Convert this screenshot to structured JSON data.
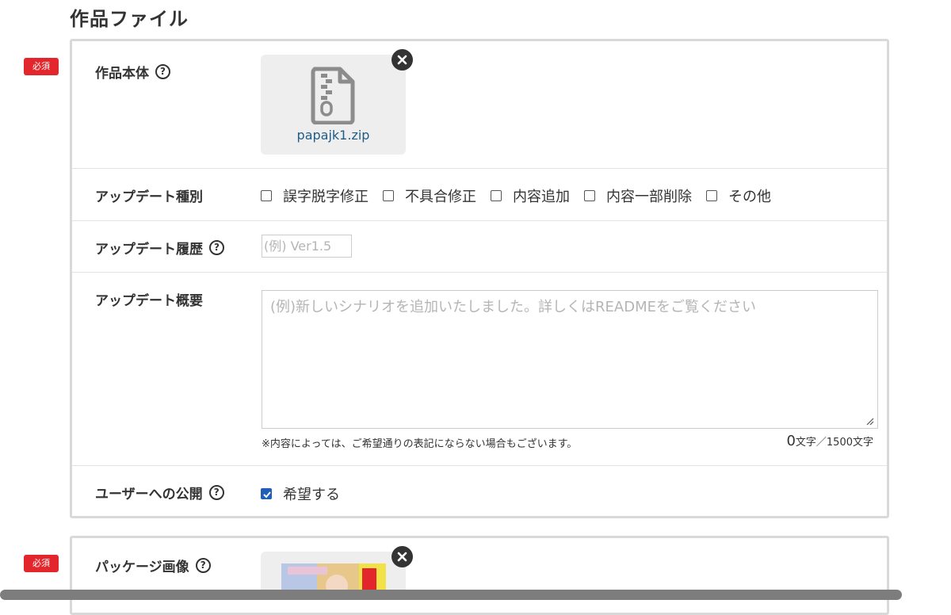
{
  "section": {
    "title": "作品ファイル"
  },
  "badges": {
    "required": "必須"
  },
  "main_file": {
    "label": "作品本体",
    "help": "?",
    "file_name": "papajk1.zip",
    "remove_icon": "close-icon"
  },
  "update_type": {
    "label": "アップデート種別",
    "options": [
      {
        "label": "誤字脱字修正",
        "checked": false
      },
      {
        "label": "不具合修正",
        "checked": false
      },
      {
        "label": "内容追加",
        "checked": false
      },
      {
        "label": "内容一部削除",
        "checked": false
      },
      {
        "label": "その他",
        "checked": false
      }
    ]
  },
  "update_history": {
    "label": "アップデート履歴",
    "help": "?",
    "placeholder": "(例) Ver1.5",
    "value": ""
  },
  "update_summary": {
    "label": "アップデート概要",
    "placeholder": "(例)新しいシナリオを追加いたしました。詳しくはREADMEをご覧ください",
    "value": "",
    "note": "※内容によっては、ご希望通りの表記にならない場合もございます。",
    "char_count": "0",
    "char_suffix": "文字／1500文字"
  },
  "publish": {
    "label": "ユーザーへの公開",
    "help": "?",
    "option_label": "希望する",
    "checked": true
  },
  "package_image": {
    "label": "パッケージ画像",
    "help": "?",
    "remove_icon": "close-icon"
  },
  "colors": {
    "required_badge": "#e3262c",
    "file_link": "#1f5c88",
    "checkbox_checked": "#1e5fb8",
    "panel_border": "#d9d9d9"
  }
}
